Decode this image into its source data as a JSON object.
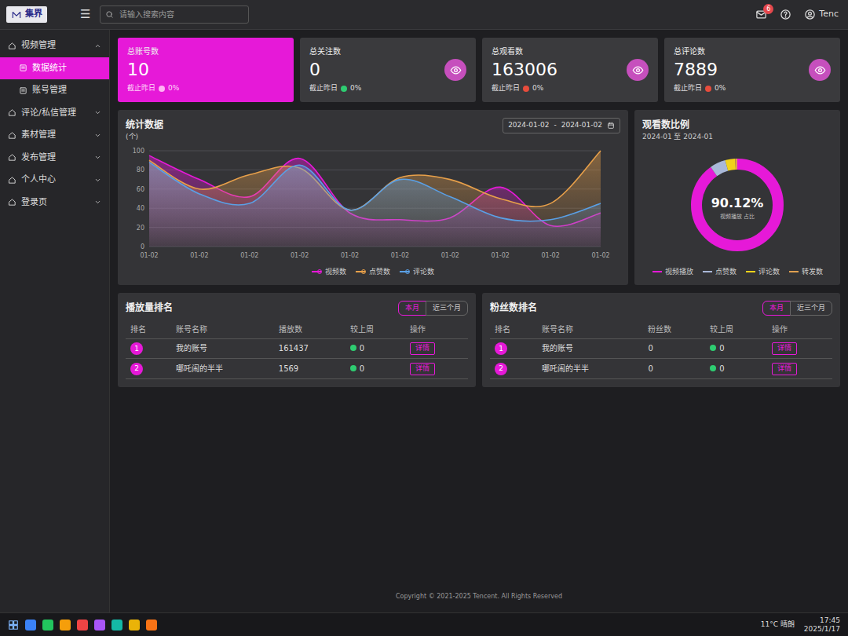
{
  "header": {
    "logo": "集界",
    "menu_icon": "☰",
    "search_placeholder": "请输入搜索内容",
    "mail_badge": "6",
    "user": "Tenc"
  },
  "sidebar": {
    "items": [
      {
        "kind": "group",
        "label": "视频管理",
        "expanded": true,
        "selected": false
      },
      {
        "kind": "sub",
        "label": "数据统计",
        "selected": true
      },
      {
        "kind": "sub",
        "label": "账号管理",
        "selected": false
      },
      {
        "kind": "group",
        "label": "评论/私信管理",
        "expanded": false,
        "selected": false
      },
      {
        "kind": "group",
        "label": "素材管理",
        "expanded": false,
        "selected": false
      },
      {
        "kind": "group",
        "label": "发布管理",
        "expanded": false,
        "selected": false
      },
      {
        "kind": "group",
        "label": "个人中心",
        "expanded": false,
        "selected": false
      },
      {
        "kind": "group",
        "label": "登录页",
        "expanded": false,
        "selected": false
      }
    ]
  },
  "stats": [
    {
      "title": "总账号数",
      "value": "10",
      "note": "截止昨日",
      "change": "0%",
      "highlighted": true,
      "color": "#ffb3f4"
    },
    {
      "title": "总关注数",
      "value": "0",
      "note": "截止昨日",
      "change": "0%",
      "highlighted": false,
      "color": "#2ecc71"
    },
    {
      "title": "总观看数",
      "value": "163006",
      "note": "截止昨日",
      "change": "0%",
      "highlighted": false,
      "color": "#e74c3c"
    },
    {
      "title": "总评论数",
      "value": "7889",
      "note": "截止昨日",
      "change": "0%",
      "highlighted": false,
      "color": "#e74c3c"
    }
  ],
  "chart": {
    "title": "统计数据",
    "unit": "(个)",
    "date_start": "2024-01-02",
    "date_separator": "-",
    "date_end": "2024-01-02",
    "y_ticks": [
      "0",
      "20",
      "40",
      "60",
      "80",
      "100"
    ],
    "x_labels": [
      "01-02",
      "01-02",
      "01-02",
      "01-02",
      "01-02",
      "01-02",
      "01-02",
      "01-02",
      "01-02",
      "01-02"
    ],
    "series": [
      {
        "name": "视频数",
        "color": "#e619d8",
        "values": [
          95,
          70,
          52,
          92,
          35,
          28,
          30,
          62,
          22,
          35
        ]
      },
      {
        "name": "点赞数",
        "color": "#e8a04a",
        "values": [
          90,
          60,
          75,
          82,
          38,
          72,
          70,
          50,
          45,
          100
        ]
      },
      {
        "name": "评论数",
        "color": "#5aa0e6",
        "values": [
          88,
          55,
          45,
          85,
          38,
          70,
          52,
          30,
          28,
          45
        ]
      }
    ]
  },
  "ratio": {
    "title": "观看数比例",
    "period": "2024-01 至 2024-01",
    "center_value": "90.12%",
    "center_label": "视频播放 占比",
    "segments": [
      {
        "label": "视频播放",
        "value": 90.12,
        "color": "#e619d8"
      },
      {
        "label": "点赞数",
        "value": 5.5,
        "color": "#a9b8d8"
      },
      {
        "label": "评论数",
        "value": 3.5,
        "color": "#f1d21b"
      },
      {
        "label": "转发数",
        "value": 0.88,
        "color": "#e0a050"
      }
    ]
  },
  "rankings": [
    {
      "title": "播放量排名",
      "ranges": [
        {
          "label": "本月",
          "selected": true
        },
        {
          "label": "近三个月",
          "selected": false
        }
      ],
      "columns": [
        "排名",
        "账号名称",
        "播放数",
        "较上周",
        "操作"
      ],
      "rows": [
        [
          "1",
          "我的账号",
          "161437",
          "0",
          "详情"
        ],
        [
          "2",
          "哪吒闹的半半",
          "1569",
          "0",
          "详情"
        ]
      ]
    },
    {
      "title": "粉丝数排名",
      "ranges": [
        {
          "label": "本月",
          "selected": true
        },
        {
          "label": "近三个月",
          "selected": false
        }
      ],
      "columns": [
        "排名",
        "账号名称",
        "粉丝数",
        "较上周",
        "操作"
      ],
      "rows": [
        [
          "1",
          "我的账号",
          "0",
          "0",
          "详情"
        ],
        [
          "2",
          "哪吒闹的半半",
          "0",
          "0",
          "详情"
        ]
      ]
    }
  ],
  "footer": "Copyright © 2021-2025 Tencent. All Rights Reserved",
  "taskbar": {
    "weather": "11°C 晴朗",
    "time": "17:45",
    "date": "2025/1/17"
  }
}
